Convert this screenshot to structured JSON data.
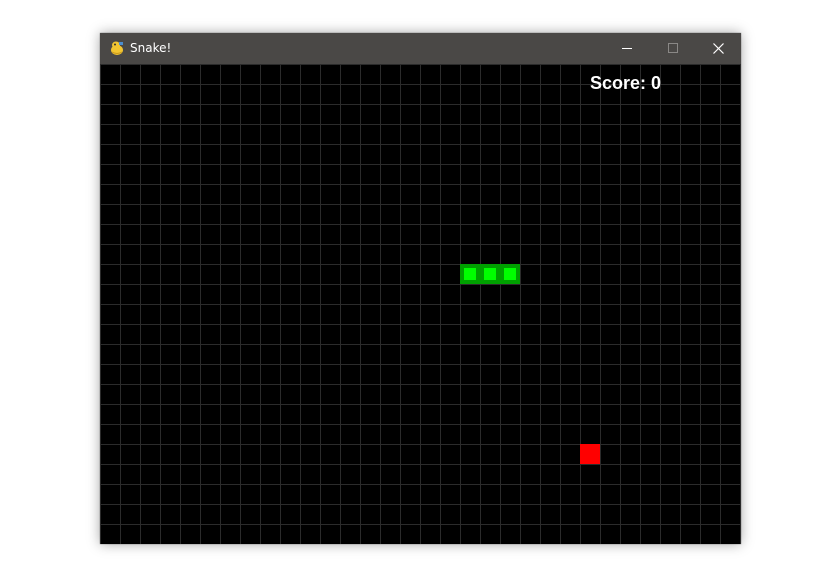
{
  "window": {
    "title": "Snake!",
    "icon": "pygame-snake-icon"
  },
  "score": {
    "label": "Score: 0",
    "value": 0
  },
  "grid": {
    "cell_size": 20,
    "columns": 32,
    "rows": 24,
    "line_color": "#2b2b2b",
    "background": "#000000"
  },
  "snake": {
    "body_color": "#00a000",
    "highlight_color": "#00ff00",
    "segments": [
      {
        "col": 18,
        "row": 10
      },
      {
        "col": 19,
        "row": 10
      },
      {
        "col": 20,
        "row": 10
      }
    ]
  },
  "food": {
    "color": "#ff0000",
    "col": 24,
    "row": 19
  },
  "colors": {
    "titlebar": "#4a4846",
    "title_text": "#ffffff"
  }
}
